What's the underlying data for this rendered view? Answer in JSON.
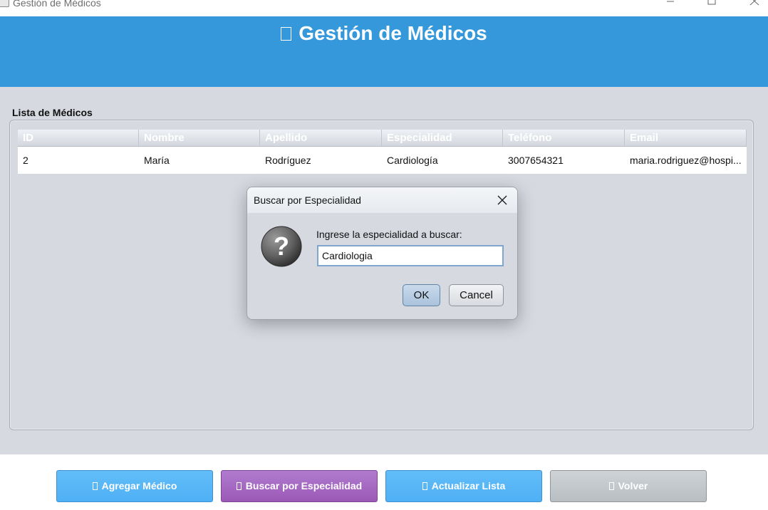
{
  "window": {
    "title": "Gestión de Médicos"
  },
  "header": {
    "title": "Gestión de Médicos"
  },
  "panel": {
    "label": "Lista de Médicos"
  },
  "table": {
    "columns": [
      "ID",
      "Nombre",
      "Apellido",
      "Especialidad",
      "Teléfono",
      "Email"
    ],
    "rows": [
      [
        "2",
        "María",
        "Rodríguez",
        "Cardiología",
        "3007654321",
        "maria.rodriguez@hospi..."
      ]
    ]
  },
  "buttons": {
    "add": "Agregar Médico",
    "search": "Buscar por Especialidad",
    "refresh": "Actualizar Lista",
    "back": "Volver"
  },
  "dialog": {
    "title": "Buscar por Especialidad",
    "prompt": "Ingrese la especialidad a buscar:",
    "input_value": "Cardiologia",
    "ok": "OK",
    "cancel": "Cancel"
  },
  "colors": {
    "header": "#3498db",
    "button_blue": "#4fb0f5",
    "button_purple": "#9b59b6",
    "button_gray": "#bdc3c7",
    "background": "#d6d9e0"
  },
  "icons": {
    "app": "app-icon",
    "dialog": "question-icon",
    "close": "close-icon"
  }
}
